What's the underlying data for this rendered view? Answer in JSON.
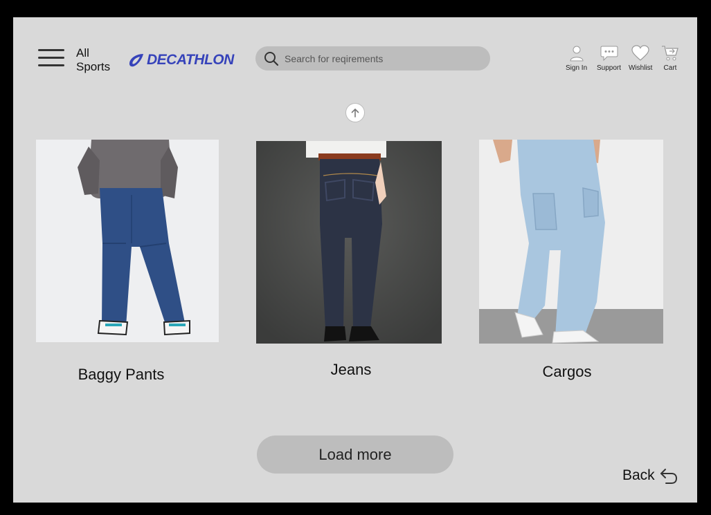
{
  "header": {
    "all_sports_line1": "All",
    "all_sports_line2": "Sports",
    "logo_text": "DECATHLON",
    "search_placeholder": "Search for reqirements",
    "icons": [
      {
        "name": "user-icon",
        "label": "Sign In"
      },
      {
        "name": "chat-icon",
        "label": "Support"
      },
      {
        "name": "heart-icon",
        "label": "Wishlist"
      },
      {
        "name": "cart-icon",
        "label": "Cart"
      }
    ]
  },
  "products": [
    {
      "name": "Baggy Pants"
    },
    {
      "name": "Jeans"
    },
    {
      "name": "Cargos"
    }
  ],
  "actions": {
    "load_more": "Load more",
    "back": "Back"
  },
  "colors": {
    "background": "#d9d9d9",
    "brand": "#3643ba",
    "button": "#bdbdbd"
  }
}
